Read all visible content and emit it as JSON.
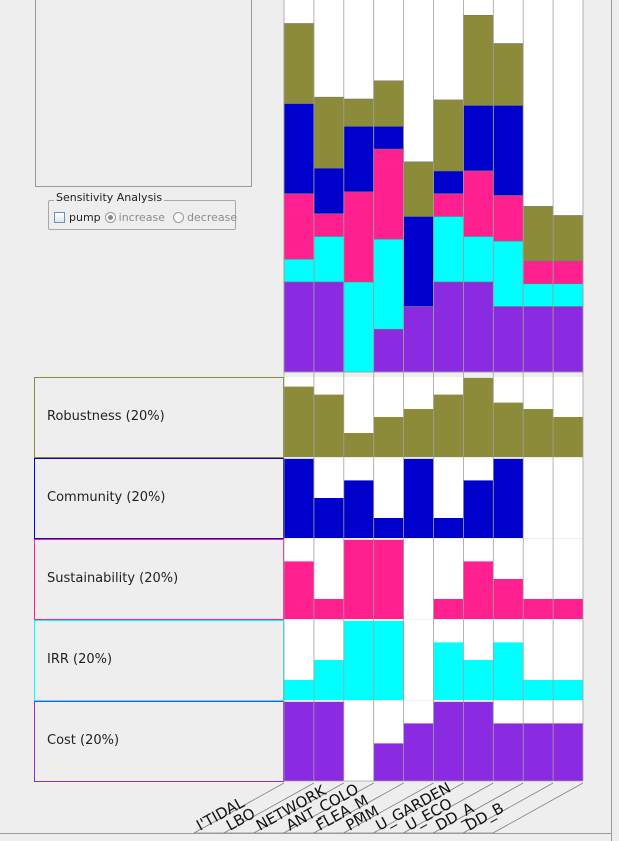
{
  "sensitivity": {
    "title": "Sensitivity Analysis",
    "checkbox_label": "pump",
    "checkbox_checked": false,
    "radio_increase": "increase",
    "radio_decrease": "decrease",
    "selected": "increase"
  },
  "colors": {
    "Robustness": "#8b8b3a",
    "Community": "#0000cc",
    "Sustainability": "#ff1f8f",
    "IRR": "#00ffff",
    "Cost": "#8a2be2"
  },
  "criteria": [
    {
      "key": "Robustness",
      "label": "Robustness (20%)"
    },
    {
      "key": "Community",
      "label": "Community (20%)"
    },
    {
      "key": "Sustainability",
      "label": "Sustainability (20%)"
    },
    {
      "key": "IRR",
      "label": "IRR (20%)"
    },
    {
      "key": "Cost",
      "label": "Cost (20%)"
    }
  ],
  "chart_data": {
    "type": "bar",
    "stacked": true,
    "categories": [
      "I'TIDAL",
      "LBO",
      "NETWORK",
      "ANT_COLO",
      "FLEA_M",
      "PMM",
      "U_GARDEN",
      "U_ECO",
      "DD_A",
      "DD_B"
    ],
    "ylim": [
      0,
      1
    ],
    "series": [
      {
        "name": "Cost",
        "values": [
          0.99,
          0.99,
          0.0,
          0.47,
          0.72,
          0.99,
          0.99,
          0.72,
          0.72,
          0.72
        ]
      },
      {
        "name": "IRR",
        "values": [
          0.25,
          0.5,
          0.99,
          0.99,
          0.0,
          0.72,
          0.5,
          0.72,
          0.25,
          0.25
        ]
      },
      {
        "name": "Sustainability",
        "values": [
          0.72,
          0.25,
          0.99,
          0.99,
          0.0,
          0.25,
          0.72,
          0.5,
          0.25,
          0.25
        ]
      },
      {
        "name": "Community",
        "values": [
          0.99,
          0.5,
          0.72,
          0.25,
          0.99,
          0.25,
          0.72,
          0.99,
          0.0,
          0.0
        ]
      },
      {
        "name": "Robustness",
        "values": [
          0.88,
          0.78,
          0.3,
          0.5,
          0.6,
          0.78,
          0.99,
          0.68,
          0.6,
          0.5
        ]
      }
    ]
  }
}
